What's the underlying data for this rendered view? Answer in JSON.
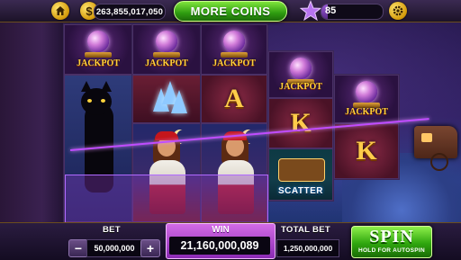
{
  "top_bar": {
    "home_icon": "home-icon",
    "coin_icon": "dollar-coin-icon",
    "coin_symbol": "$",
    "balance": "263,855,017,050",
    "more_coins_label": "MORE COINS",
    "star_icon": "star-icon",
    "level": "85",
    "level_progress": 0.1,
    "settings_icon": "gear-icon"
  },
  "reels": {
    "jackpot_text": "JACKPOT",
    "letter_A": "A",
    "letter_K": "K",
    "scatter_text": "SCATTER"
  },
  "bottom_bar": {
    "bet_label": "BET",
    "bet_value": "50,000,000",
    "minus_label": "−",
    "plus_label": "+",
    "win_label": "WIN",
    "win_value": "21,160,000,089",
    "total_bet_label": "TOTAL BET",
    "total_bet_value": "1,250,000,000",
    "spin_label": "SPIN",
    "spin_sublabel": "HOLD FOR AUTOSPIN"
  },
  "colors": {
    "accent_green": "#2e9c10",
    "win_purple": "#b84cdc",
    "gold": "#ffd23c"
  }
}
